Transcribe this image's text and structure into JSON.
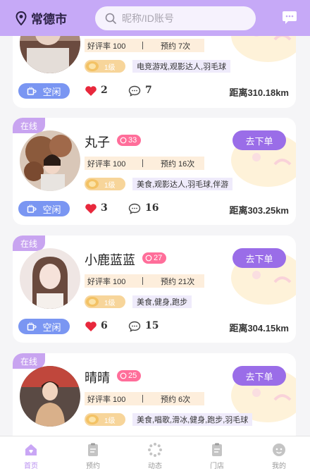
{
  "header": {
    "city": "常德市",
    "search_placeholder": "昵称/ID账号"
  },
  "cards": [
    {
      "name": "",
      "online_label": "",
      "fans": "",
      "order_label": "",
      "rating": "好评率 100",
      "orders": "预约 7次",
      "level": "1级",
      "tags": "电竞游戏,观影达人,羽毛球",
      "status": "空闲",
      "likes": "2",
      "comments": "7",
      "distance": "距离310.18km"
    },
    {
      "name": "丸子",
      "online_label": "在线",
      "fans": "33",
      "order_label": "去下单",
      "rating": "好评率 100",
      "orders": "预约 16次",
      "level": "1级",
      "tags": "美食,观影达人,羽毛球,伴游",
      "status": "空闲",
      "likes": "3",
      "comments": "16",
      "distance": "距离303.25km"
    },
    {
      "name": "小鹿蓝蓝",
      "online_label": "在线",
      "fans": "27",
      "order_label": "去下单",
      "rating": "好评率 100",
      "orders": "预约 21次",
      "level": "1级",
      "tags": "美食,健身,跑步",
      "status": "空闲",
      "likes": "6",
      "comments": "15",
      "distance": "距离304.15km"
    },
    {
      "name": "晴晴",
      "online_label": "在线",
      "fans": "25",
      "order_label": "去下单",
      "rating": "好评率 100",
      "orders": "预约 6次",
      "level": "1级",
      "tags": "美食,唱歌,滑冰,健身,跑步,羽毛球",
      "status": "",
      "likes": "",
      "comments": "",
      "distance": ""
    }
  ],
  "tabbar": {
    "items": [
      {
        "label": "首页",
        "icon": "home-icon"
      },
      {
        "label": "预约",
        "icon": "clipboard-icon"
      },
      {
        "label": "动态",
        "icon": "loading-icon"
      },
      {
        "label": "门店",
        "icon": "store-icon"
      },
      {
        "label": "我的",
        "icon": "profile-icon"
      }
    ]
  },
  "colors": {
    "header": "#c6a9f7",
    "accent": "#9a6de8",
    "idle": "#7a96f2",
    "online_badge": "#c8a4f0",
    "fans_badge": "#ff6e9a",
    "active_tab": "#b98ff0"
  }
}
